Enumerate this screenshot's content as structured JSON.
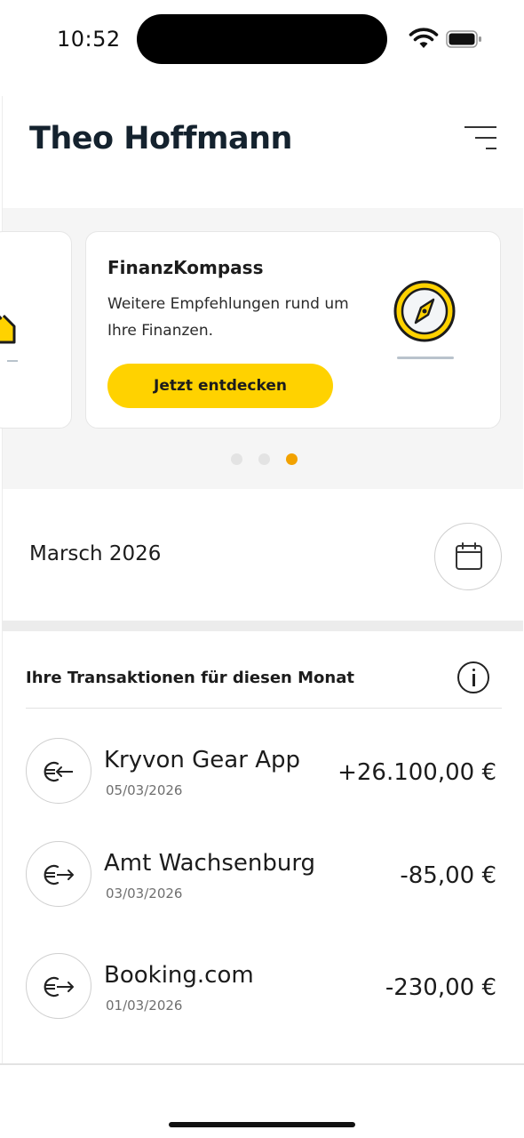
{
  "status_bar": {
    "time": "10:52"
  },
  "header": {
    "user_name": "Theo Hoffmann",
    "filter_icon": "filter-lines-icon"
  },
  "carousel": {
    "card": {
      "title": "FinanzKompass",
      "description": "Weitere Empfehlungen rund um Ihre Finanzen.",
      "button_label": "Jetzt entdecken",
      "icon": "compass-icon"
    },
    "page_count": 3,
    "active_page": 3,
    "accent_color": "#ffd200",
    "active_dot_color": "#f2a200"
  },
  "month": {
    "label": "Marsch 2026",
    "icon": "calendar-icon"
  },
  "transactions": {
    "heading": "Ihre Transaktionen für diesen Monat",
    "items": [
      {
        "name": "Kryvon Gear App",
        "date": "05/03/2026",
        "amount": "+26.100,00 €",
        "icon": "euro-incoming-icon"
      },
      {
        "name": "Amt Wachsenburg",
        "date": "03/03/2026",
        "amount": "-85,00 €",
        "icon": "euro-outgoing-icon"
      },
      {
        "name": "Booking.com",
        "date": "01/03/2026",
        "amount": "-230,00 €",
        "icon": "euro-outgoing-icon"
      }
    ]
  }
}
